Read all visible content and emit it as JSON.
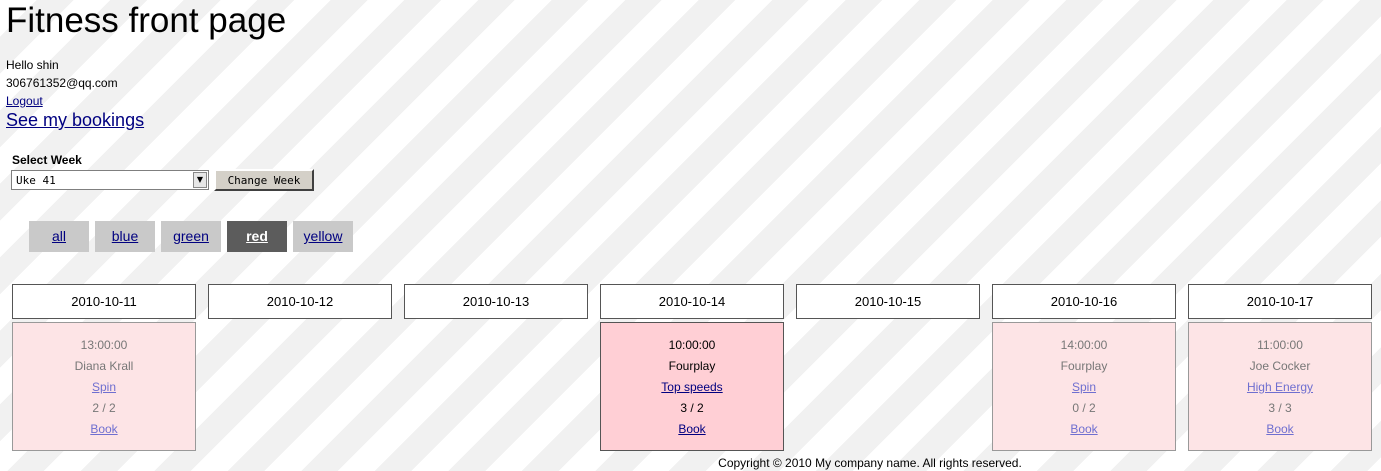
{
  "page": {
    "title": "Fitness front page",
    "greeting": "Hello shin",
    "email": "306761352@qq.com",
    "logout_label": "Logout",
    "bookings_label": "See my bookings"
  },
  "week": {
    "label": "Select Week",
    "selected": "Uke 41",
    "button_label": "Change Week"
  },
  "filters": [
    {
      "label": "all",
      "active": false
    },
    {
      "label": "blue",
      "active": false
    },
    {
      "label": "green",
      "active": false
    },
    {
      "label": "red",
      "active": true
    },
    {
      "label": "yellow",
      "active": false
    }
  ],
  "days": [
    {
      "date": "2010-10-11",
      "session": {
        "time": "13:00:00",
        "instructor": "Diana Krall",
        "class": "Spin",
        "capacity": "2 / 2",
        "book": "Book",
        "highlight": false
      }
    },
    {
      "date": "2010-10-12",
      "session": null
    },
    {
      "date": "2010-10-13",
      "session": null
    },
    {
      "date": "2010-10-14",
      "session": {
        "time": "10:00:00",
        "instructor": "Fourplay",
        "class": "Top speeds",
        "capacity": "3 / 2",
        "book": "Book",
        "highlight": true
      }
    },
    {
      "date": "2010-10-15",
      "session": null
    },
    {
      "date": "2010-10-16",
      "session": {
        "time": "14:00:00",
        "instructor": "Fourplay",
        "class": "Spin",
        "capacity": "0 / 2",
        "book": "Book",
        "highlight": false
      }
    },
    {
      "date": "2010-10-17",
      "session": {
        "time": "11:00:00",
        "instructor": "Joe Cocker",
        "class": "High Energy",
        "capacity": "3 / 3",
        "book": "Book",
        "highlight": false
      }
    }
  ],
  "footer": "Copyright © 2010 My company name. All rights reserved."
}
